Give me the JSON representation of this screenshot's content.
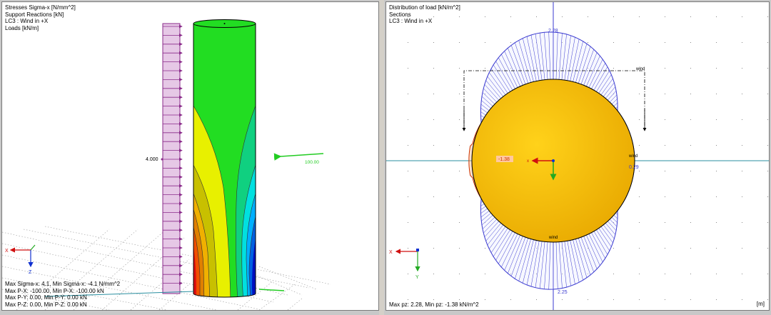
{
  "left_view": {
    "header": [
      "Stresses Sigma-x [N/mm^2]",
      "Support Reactions [kN]",
      "LC3 : Wind in +X",
      "Loads [kN/m]"
    ],
    "footer": [
      "Max Sigma-x: 4.1, Min Sigma-x: -4.1 N/mm^2",
      "Max P-X: -100.00, Min P-X: -100.00 kN",
      "Max P-Y: 0.00, Min P-Y: 0.00 kN",
      "Max P-Z: 0.00, Min P-Z: 0.00 kN"
    ],
    "load_value": "4.000",
    "reaction_value": "100.00",
    "axes": {
      "x": "X",
      "z": "Z"
    },
    "colors": {
      "load": "#8a2a8a",
      "load_fill": "#e6c8e6",
      "reaction": "#22cc22",
      "cylinder_top": "#22dd22"
    }
  },
  "right_view": {
    "header": [
      "Distribution of load [kN/m^2]",
      "Sections",
      "LC3 : Wind in +X"
    ],
    "footer": "Max pz: 2.28, Min pz: -1.38 kN/m^2",
    "unit": "[m]",
    "labels": {
      "top_value": "2.28",
      "bottom_value": "2.25",
      "min_value": "-1.38",
      "right_value": "0.29",
      "wind_top": "wind",
      "wind_right": "wind",
      "wind_bottom": "wind"
    },
    "axes": {
      "x": "X",
      "y": "Y"
    },
    "colors": {
      "pressure": "#3a3ad0",
      "suction": "#cc3300",
      "section_fill": "#f5c20a",
      "axis_line": "#2a8fa0"
    }
  }
}
